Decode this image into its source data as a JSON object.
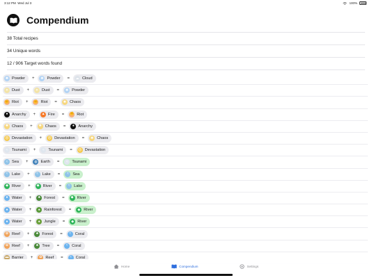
{
  "status": {
    "time": "3:12 PM",
    "date": "Wed Jul 3",
    "battery": "100%"
  },
  "header": {
    "title": "Compendium"
  },
  "stats": [
    "38 Total recipes",
    "34 Unique words",
    "12 / 906 Target words found"
  ],
  "colors": {
    "chip": "#ebebef",
    "chip_highlight": "#c9f0cc",
    "accent": "#2f6fde"
  },
  "recipes": [
    {
      "a": {
        "label": "Powder",
        "icon": "powder-icon",
        "glyph": "✺",
        "color": "#b3d4f5"
      },
      "b": {
        "label": "Powder",
        "icon": "powder-icon",
        "glyph": "✺",
        "color": "#b3d4f5"
      },
      "result": {
        "label": "Cloud",
        "icon": "cloud-icon",
        "glyph": "☁",
        "color": "#dde3ea",
        "highlight": false
      }
    },
    {
      "a": {
        "label": "Dust",
        "icon": "dust-icon",
        "glyph": "✦",
        "color": "#f3e4a8"
      },
      "b": {
        "label": "Dust",
        "icon": "dust-icon",
        "glyph": "✦",
        "color": "#f3e4a8"
      },
      "result": {
        "label": "Powder",
        "icon": "powder-icon",
        "glyph": "✺",
        "color": "#b3d4f5",
        "highlight": false
      }
    },
    {
      "a": {
        "label": "Riot",
        "icon": "riot-icon",
        "glyph": "✊",
        "color": "#f7b17a"
      },
      "b": {
        "label": "Riot",
        "icon": "riot-icon",
        "glyph": "✊",
        "color": "#f7b17a"
      },
      "result": {
        "label": "Chaos",
        "icon": "chaos-icon",
        "glyph": "✺",
        "color": "#f7d77e",
        "highlight": false
      }
    },
    {
      "a": {
        "label": "Anarchy",
        "icon": "anarchy-icon",
        "glyph": "●",
        "color": "#111111"
      },
      "b": {
        "label": "Fire",
        "icon": "fire-icon",
        "glyph": "▲",
        "color": "#f77b2b"
      },
      "result": {
        "label": "Riot",
        "icon": "riot-icon",
        "glyph": "✊",
        "color": "#f7b17a",
        "highlight": false
      }
    },
    {
      "a": {
        "label": "Chaos",
        "icon": "chaos-icon",
        "glyph": "✺",
        "color": "#f7d77e"
      },
      "b": {
        "label": "Chaos",
        "icon": "chaos-icon",
        "glyph": "✺",
        "color": "#f7d77e"
      },
      "result": {
        "label": "Anarchy",
        "icon": "anarchy-icon",
        "glyph": "●",
        "color": "#111111",
        "highlight": false
      }
    },
    {
      "a": {
        "label": "Devastation",
        "icon": "devastation-icon",
        "glyph": "☹",
        "color": "#f5c94e"
      },
      "b": {
        "label": "Devastation",
        "icon": "devastation-icon",
        "glyph": "☹",
        "color": "#f5c94e"
      },
      "result": {
        "label": "Chaos",
        "icon": "chaos-icon",
        "glyph": "✺",
        "color": "#f7d77e",
        "highlight": false
      }
    },
    {
      "a": {
        "label": "Tsunami",
        "icon": "tsunami-icon",
        "glyph": "≈",
        "color": "#dfe6ee"
      },
      "b": {
        "label": "Tsunami",
        "icon": "tsunami-icon",
        "glyph": "≈",
        "color": "#dfe6ee"
      },
      "result": {
        "label": "Devastation",
        "icon": "devastation-icon",
        "glyph": "☹",
        "color": "#f5c94e",
        "highlight": false
      }
    },
    {
      "a": {
        "label": "Sea",
        "icon": "sea-icon",
        "glyph": "≈",
        "color": "#8fc3e8"
      },
      "b": {
        "label": "Earth",
        "icon": "earth-icon",
        "glyph": "◍",
        "color": "#3d7fb8"
      },
      "result": {
        "label": "Tsunami",
        "icon": "tsunami-icon",
        "glyph": "≈",
        "color": "#dfe6ee",
        "highlight": true
      }
    },
    {
      "a": {
        "label": "Lake",
        "icon": "lake-icon",
        "glyph": "≈",
        "color": "#8fc3e8"
      },
      "b": {
        "label": "Lake",
        "icon": "lake-icon",
        "glyph": "≈",
        "color": "#8fc3e8"
      },
      "result": {
        "label": "Sea",
        "icon": "sea-icon",
        "glyph": "≈",
        "color": "#8fc3e8",
        "highlight": true
      }
    },
    {
      "a": {
        "label": "River",
        "icon": "river-icon",
        "glyph": "◆",
        "color": "#2fb55a"
      },
      "b": {
        "label": "River",
        "icon": "river-icon",
        "glyph": "◆",
        "color": "#2fb55a"
      },
      "result": {
        "label": "Lake",
        "icon": "lake-icon",
        "glyph": "≈",
        "color": "#8fc3e8",
        "highlight": true
      }
    },
    {
      "a": {
        "label": "Water",
        "icon": "water-icon",
        "glyph": "●",
        "color": "#6cb4ef"
      },
      "b": {
        "label": "Forest",
        "icon": "forest-icon",
        "glyph": "♣",
        "color": "#4a8a3a"
      },
      "result": {
        "label": "River",
        "icon": "river-icon",
        "glyph": "◆",
        "color": "#2fb55a",
        "highlight": true
      }
    },
    {
      "a": {
        "label": "Water",
        "icon": "water-icon",
        "glyph": "●",
        "color": "#6cb4ef"
      },
      "b": {
        "label": "Rainforest",
        "icon": "rainforest-icon",
        "glyph": "♠",
        "color": "#5a9a3a"
      },
      "result": {
        "label": "River",
        "icon": "river-icon",
        "glyph": "◆",
        "color": "#2fb55a",
        "highlight": true
      }
    },
    {
      "a": {
        "label": "Water",
        "icon": "water-icon",
        "glyph": "●",
        "color": "#6cb4ef"
      },
      "b": {
        "label": "Jungle",
        "icon": "jungle-icon",
        "glyph": "♠",
        "color": "#6aa03a"
      },
      "result": {
        "label": "River",
        "icon": "river-icon",
        "glyph": "◆",
        "color": "#2fb55a",
        "highlight": true
      }
    },
    {
      "a": {
        "label": "Reef",
        "icon": "reef-icon",
        "glyph": "✿",
        "color": "#f0a35a"
      },
      "b": {
        "label": "Forest",
        "icon": "forest-icon",
        "glyph": "♣",
        "color": "#4a8a3a"
      },
      "result": {
        "label": "Coral",
        "icon": "coral-icon",
        "glyph": "≈",
        "color": "#6cb4ef",
        "highlight": false
      }
    },
    {
      "a": {
        "label": "Reef",
        "icon": "reef-icon",
        "glyph": "✿",
        "color": "#f0a35a"
      },
      "b": {
        "label": "Tree",
        "icon": "tree-icon",
        "glyph": "♣",
        "color": "#4a8a3a"
      },
      "result": {
        "label": "Coral",
        "icon": "coral-icon",
        "glyph": "≈",
        "color": "#6cb4ef",
        "highlight": false
      }
    },
    {
      "a": {
        "label": "Barrier",
        "icon": "barrier-icon",
        "glyph": "▬",
        "color": "#c9a86a"
      },
      "b": {
        "label": "Reef",
        "icon": "reef-icon",
        "glyph": "✿",
        "color": "#f0a35a"
      },
      "result": {
        "label": "Coral",
        "icon": "coral-icon",
        "glyph": "≈",
        "color": "#6cb4ef",
        "highlight": false
      }
    }
  ],
  "tabs": [
    {
      "label": "Home",
      "icon": "home-icon",
      "active": false
    },
    {
      "label": "Compendium",
      "icon": "book-icon",
      "active": true
    },
    {
      "label": "Settings",
      "icon": "gear-icon",
      "active": false
    }
  ]
}
